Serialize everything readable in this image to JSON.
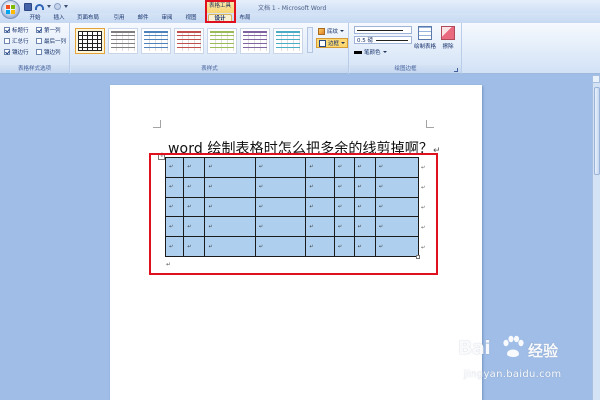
{
  "window": {
    "title": "文档 1 - Microsoft Word",
    "context_tab_header": "表格工具"
  },
  "tabs": [
    {
      "label": "开始"
    },
    {
      "label": "插入"
    },
    {
      "label": "页面布局"
    },
    {
      "label": "引用"
    },
    {
      "label": "邮件"
    },
    {
      "label": "审阅"
    },
    {
      "label": "视图"
    },
    {
      "label": "设计"
    },
    {
      "label": "布局"
    }
  ],
  "active_tab": "设计",
  "ribbon": {
    "style_options": {
      "label": "表格样式选项",
      "options": [
        {
          "label": "标题行",
          "checked": true
        },
        {
          "label": "第一列",
          "checked": true
        },
        {
          "label": "汇总行",
          "checked": false
        },
        {
          "label": "最后一列",
          "checked": false
        },
        {
          "label": "镶边行",
          "checked": true
        },
        {
          "label": "镶边列",
          "checked": false
        }
      ]
    },
    "table_styles": {
      "label": "表样式",
      "shading_label": "底纹",
      "borders_label": "边框",
      "thumb_colors": [
        "#000000",
        "#7f7f7f",
        "#4f81bd",
        "#c0504d",
        "#9bbb59",
        "#8064a2",
        "#4bacc6"
      ]
    },
    "draw_borders": {
      "label": "绘图边框",
      "line_weight": "0.5 磅",
      "pen_color_label": "笔颜色",
      "draw_table_label": "绘制表格",
      "erase_label": "擦除"
    }
  },
  "document": {
    "heading": "word 绘制表格时怎么把多余的线剪掉啊？",
    "table": {
      "rows": 5,
      "cols": 8,
      "cell_mark": "↵"
    }
  },
  "watermark": {
    "logo": "Bai",
    "logo_suffix": "经验",
    "url": "jingyan.baidu.com"
  },
  "colors": {
    "highlight": "#e0101e",
    "table_fill": "#aed0ee",
    "ribbon_bg": "#dfe9f8",
    "workspace_bg": "#9fbde6"
  }
}
